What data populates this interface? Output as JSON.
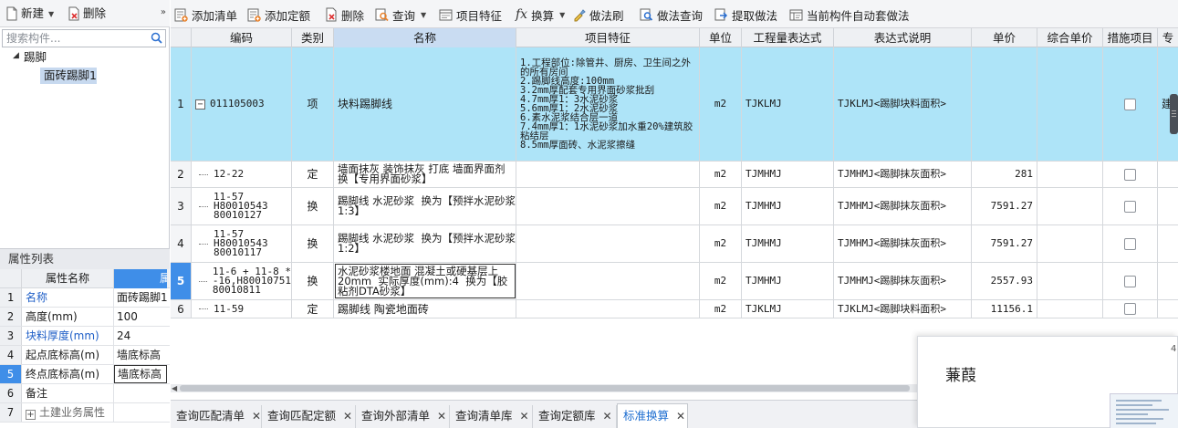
{
  "left_toolbar": {
    "new_label": "新建",
    "delete_label": "删除",
    "collapse_label": "»"
  },
  "search": {
    "placeholder": "搜索构件..."
  },
  "tree": {
    "root": "踢脚",
    "child": "面砖踢脚1"
  },
  "properties": {
    "title": "属性列表",
    "header_name": "属性名称",
    "header_value": "属",
    "rows": [
      {
        "num": "1",
        "name": "名称",
        "value": "面砖踢脚1"
      },
      {
        "num": "2",
        "name": "高度(mm)",
        "value": "100"
      },
      {
        "num": "3",
        "name": "块料厚度(mm)",
        "value": "24"
      },
      {
        "num": "4",
        "name": "起点底标高(m)",
        "value": "墙底标高"
      },
      {
        "num": "5",
        "name": "终点底标高(m)",
        "value": "墙底标高"
      },
      {
        "num": "6",
        "name": "备注",
        "value": ""
      },
      {
        "num": "7",
        "name": "土建业务属性",
        "value": ""
      }
    ]
  },
  "toolbar": {
    "add_list": "添加清单",
    "add_quota": "添加定额",
    "delete": "删除",
    "query": "查询",
    "item_feature": "项目特征",
    "convert": "换算",
    "method_brush": "做法刷",
    "method_query": "做法查询",
    "extract_method": "提取做法",
    "auto_apply": "当前构件自动套做法"
  },
  "grid": {
    "headers": [
      "编码",
      "类别",
      "名称",
      "项目特征",
      "单位",
      "工程量表达式",
      "表达式说明",
      "单价",
      "综合单价",
      "措施项目",
      "专"
    ],
    "rows": [
      {
        "num": "1",
        "code": "011105003",
        "type": "项",
        "name": "块料踢脚线",
        "feature": "1.工程部位:除管井、厨房、卫生间之外的所有房间\n2.踢脚线高度:100mm\n3.2mm厚配套专用界面砂浆批刮\n4.7mm厚1：3水泥砂浆\n5.6mm厚1：2水泥砂浆\n6.素水泥浆结合层一道\n7.4mm厚1：1水泥砂浆加水重20%建筑胶粘结层\n8.5mm厚面砖、水泥浆擦缝",
        "unit": "m2",
        "expr": "TJKLMJ",
        "expr_desc": "TJKLMJ<踢脚块料面积>",
        "price": "",
        "comp_price": "",
        "extra": "建"
      },
      {
        "num": "2",
        "code": "12-22",
        "type": "定",
        "name": "墙面抹灰 装饰抹灰 打底 墙面界面剂  换【专用界面砂浆】",
        "feature": "",
        "unit": "m2",
        "expr": "TJMHMJ",
        "expr_desc": "TJMHMJ<踢脚抹灰面积>",
        "price": "281",
        "comp_price": "",
        "extra": ""
      },
      {
        "num": "3",
        "code": "11-57\nH80010543\n80010127",
        "type": "换",
        "name": "踢脚线 水泥砂浆  换为【预拌水泥砂浆 1:3】",
        "feature": "",
        "unit": "m2",
        "expr": "TJMHMJ",
        "expr_desc": "TJMHMJ<踢脚抹灰面积>",
        "price": "7591.27",
        "comp_price": "",
        "extra": ""
      },
      {
        "num": "4",
        "code": "11-57\nH80010543\n80010117",
        "type": "换",
        "name": "踢脚线 水泥砂浆  换为【预拌水泥砂浆 1:2】",
        "feature": "",
        "unit": "m2",
        "expr": "TJMHMJ",
        "expr_desc": "TJMHMJ<踢脚抹灰面积>",
        "price": "7591.27",
        "comp_price": "",
        "extra": ""
      },
      {
        "num": "5",
        "code": "11-6 + 11-8 *\n-16,H80010751\n80010811",
        "type": "换",
        "name": "水泥砂浆楼地面 混凝土或硬基层上 20mm  实际厚度(mm):4  换为【胶粘剂DTA砂浆】",
        "feature": "",
        "unit": "m2",
        "expr": "TJMHMJ",
        "expr_desc": "TJMHMJ<踢脚抹灰面积>",
        "price": "2557.93",
        "comp_price": "",
        "extra": ""
      },
      {
        "num": "6",
        "code": "11-59",
        "type": "定",
        "name": "踢脚线 陶瓷地面砖",
        "feature": "",
        "unit": "m2",
        "expr": "TJKLMJ",
        "expr_desc": "TJKLMJ<踢脚块料面积>",
        "price": "11156.1",
        "comp_price": "",
        "extra": ""
      }
    ]
  },
  "bottom_tabs": [
    "查询匹配清单",
    "查询匹配定额",
    "查询外部清单",
    "查询清单库",
    "查询定额库",
    "标准换算"
  ],
  "popup": {
    "name": "蒹葭",
    "corner": "4"
  },
  "colors": {
    "selected_row": "#aee4f8",
    "accent": "#3f8ee8",
    "active_tab_text": "#1f6fd1",
    "link_blue": "#1f5fc7"
  }
}
